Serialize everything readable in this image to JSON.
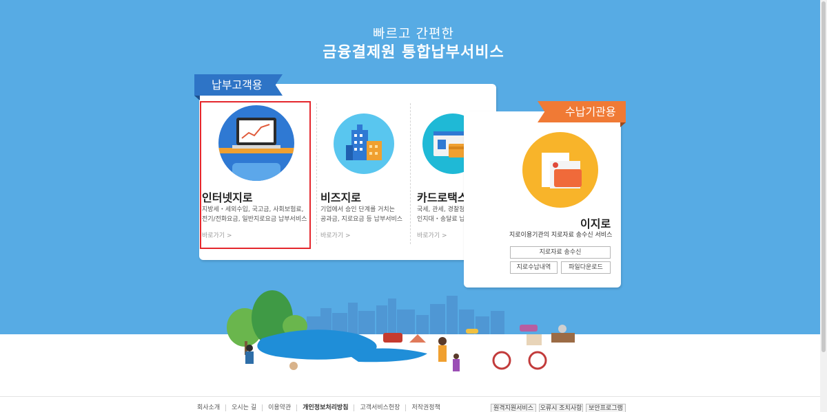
{
  "hero": {
    "subtitle": "빠르고 간편한",
    "title": "금융결제원 통합납부서비스"
  },
  "customer_panel": {
    "ribbon": "납부고객용",
    "cards": [
      {
        "title": "인터넷지로",
        "desc": "지방세・세외수입, 국고금, 사회보험료,\n전기/전화요금, 일반지로요금 납부서비스",
        "link": "바로가기 >",
        "icon": "laptop-chart-icon"
      },
      {
        "title": "비즈지로",
        "desc": "기업에서 승인 단계를 거치는\n공과금, 지로요금 등 납부서비스",
        "link": "바로가기 >",
        "icon": "building-icon"
      },
      {
        "title": "카드로택스",
        "desc": "국세, 관세, 경찰청 과태료,\n인지대・송달료 납부서비스",
        "link": "바로가기 >",
        "icon": "card-icon"
      }
    ]
  },
  "agency_panel": {
    "ribbon": "수납기관용",
    "title": "이지로",
    "desc": "지로이용기관의 지로자료 송수신 서비스",
    "buttons": [
      "지로자료 송수신",
      "지로수납내역",
      "파일다운로드"
    ],
    "icon": "folder-document-icon"
  },
  "footer": {
    "links": [
      "회사소개",
      "오시는 길",
      "이용약관",
      "개인정보처리방침",
      "고객서비스헌장",
      "저작권정책"
    ],
    "buttons": [
      "원격지원서비스",
      "오류시 조치사항",
      "보안프로그램"
    ]
  },
  "colors": {
    "hero_bg": "#57abe4",
    "ribbon_customer": "#2e74c6",
    "ribbon_agency": "#f07a35",
    "highlight": "#e4262c"
  }
}
